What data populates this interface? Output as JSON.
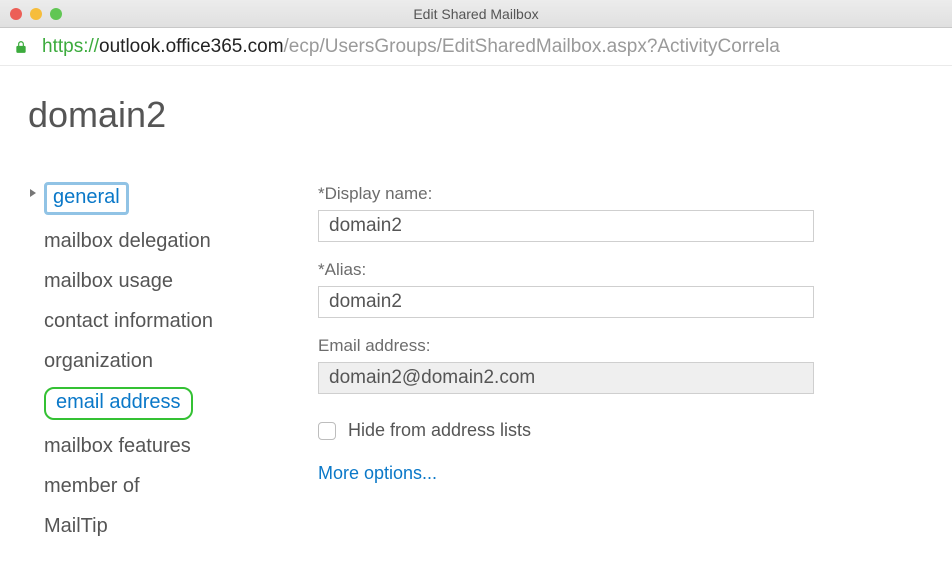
{
  "window": {
    "title": "Edit Shared Mailbox"
  },
  "url": {
    "protocol": "https://",
    "host": "outlook.office365.com",
    "path": "/ecp/UsersGroups/EditSharedMailbox.aspx?ActivityCorrela"
  },
  "page": {
    "title": "domain2"
  },
  "sidebar": {
    "items": [
      {
        "label": "general",
        "active": true
      },
      {
        "label": "mailbox delegation"
      },
      {
        "label": "mailbox usage"
      },
      {
        "label": "contact information"
      },
      {
        "label": "organization"
      },
      {
        "label": "email address",
        "highlighted": true
      },
      {
        "label": "mailbox features"
      },
      {
        "label": "member of"
      },
      {
        "label": "MailTip"
      }
    ]
  },
  "form": {
    "display_name_label": "*Display name:",
    "display_name_value": "domain2",
    "alias_label": "*Alias:",
    "alias_value": "domain2",
    "email_label": "Email address:",
    "email_value": "domain2@domain2.com",
    "hide_label": "Hide from address lists",
    "hide_checked": false,
    "more_options_label": "More options..."
  }
}
